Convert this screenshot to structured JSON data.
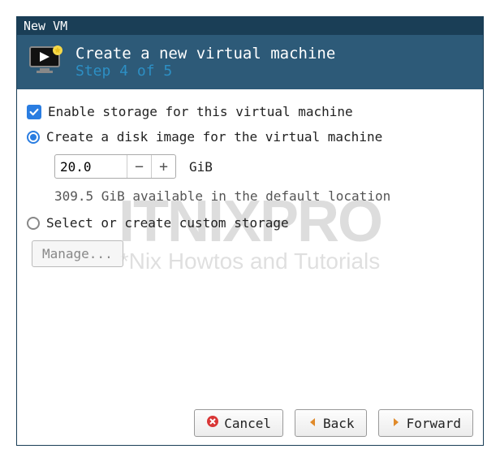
{
  "window": {
    "title": "New VM"
  },
  "header": {
    "title": "Create a new virtual machine",
    "step": "Step 4 of 5"
  },
  "storage": {
    "enable_label": "Enable storage for this virtual machine",
    "create_label": "Create a disk image for the virtual machine",
    "size_value": "20.0",
    "size_unit": "GiB",
    "available": "309.5 GiB available in the default location",
    "custom_label": "Select or create custom storage",
    "manage_label": "Manage..."
  },
  "buttons": {
    "cancel": "Cancel",
    "back": "Back",
    "forward": "Forward"
  },
  "watermark": {
    "title": "ITNIXPRO",
    "subtitle": "*Nix Howtos and Tutorials"
  }
}
